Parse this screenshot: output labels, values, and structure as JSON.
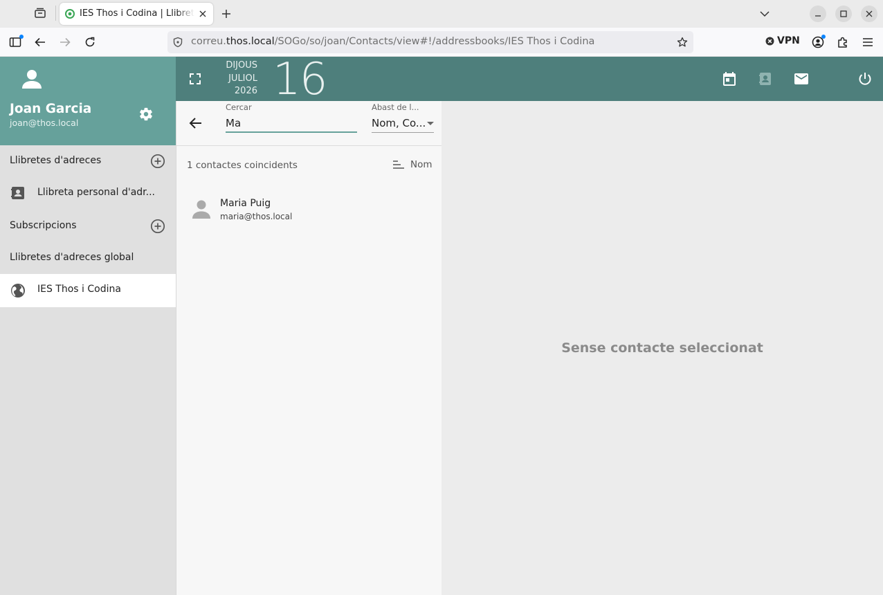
{
  "browser": {
    "tab_title": "IES Thos i Codina | Llibreta d'adreces",
    "url_prefix": "correu.",
    "url_host": "thos.local",
    "url_path": "/SOGo/so/joan/Contacts/view#!/addressbooks/IES Thos i Codina",
    "vpn_label": "VPN"
  },
  "user": {
    "name": "Joan Garcia",
    "email": "joan@thos.local"
  },
  "sidebar": {
    "address_books_title": "Llibretes d'adreces",
    "personal_book": "Llibreta personal d'adr...",
    "subscriptions_title": "Subscripcions",
    "global_title": "Llibretes d'adreces global",
    "global_book": "IES Thos i Codina"
  },
  "date": {
    "weekday": "DIJOUS",
    "month": "JULIOL",
    "year": "2026",
    "day": "16"
  },
  "search": {
    "label": "Cercar",
    "value": "Ma",
    "scope_label": "Abast de l...",
    "scope_value": "Nom, Co..."
  },
  "list": {
    "count_text": "1 contactes coincidents",
    "sort_label": "Nom",
    "contacts": [
      {
        "name": "Maria Puig",
        "email": "maria@thos.local"
      }
    ]
  },
  "detail": {
    "empty_message": "Sense contacte seleccionat"
  },
  "colors": {
    "accent": "#66a19b",
    "toolbar": "#4e7f7c"
  }
}
